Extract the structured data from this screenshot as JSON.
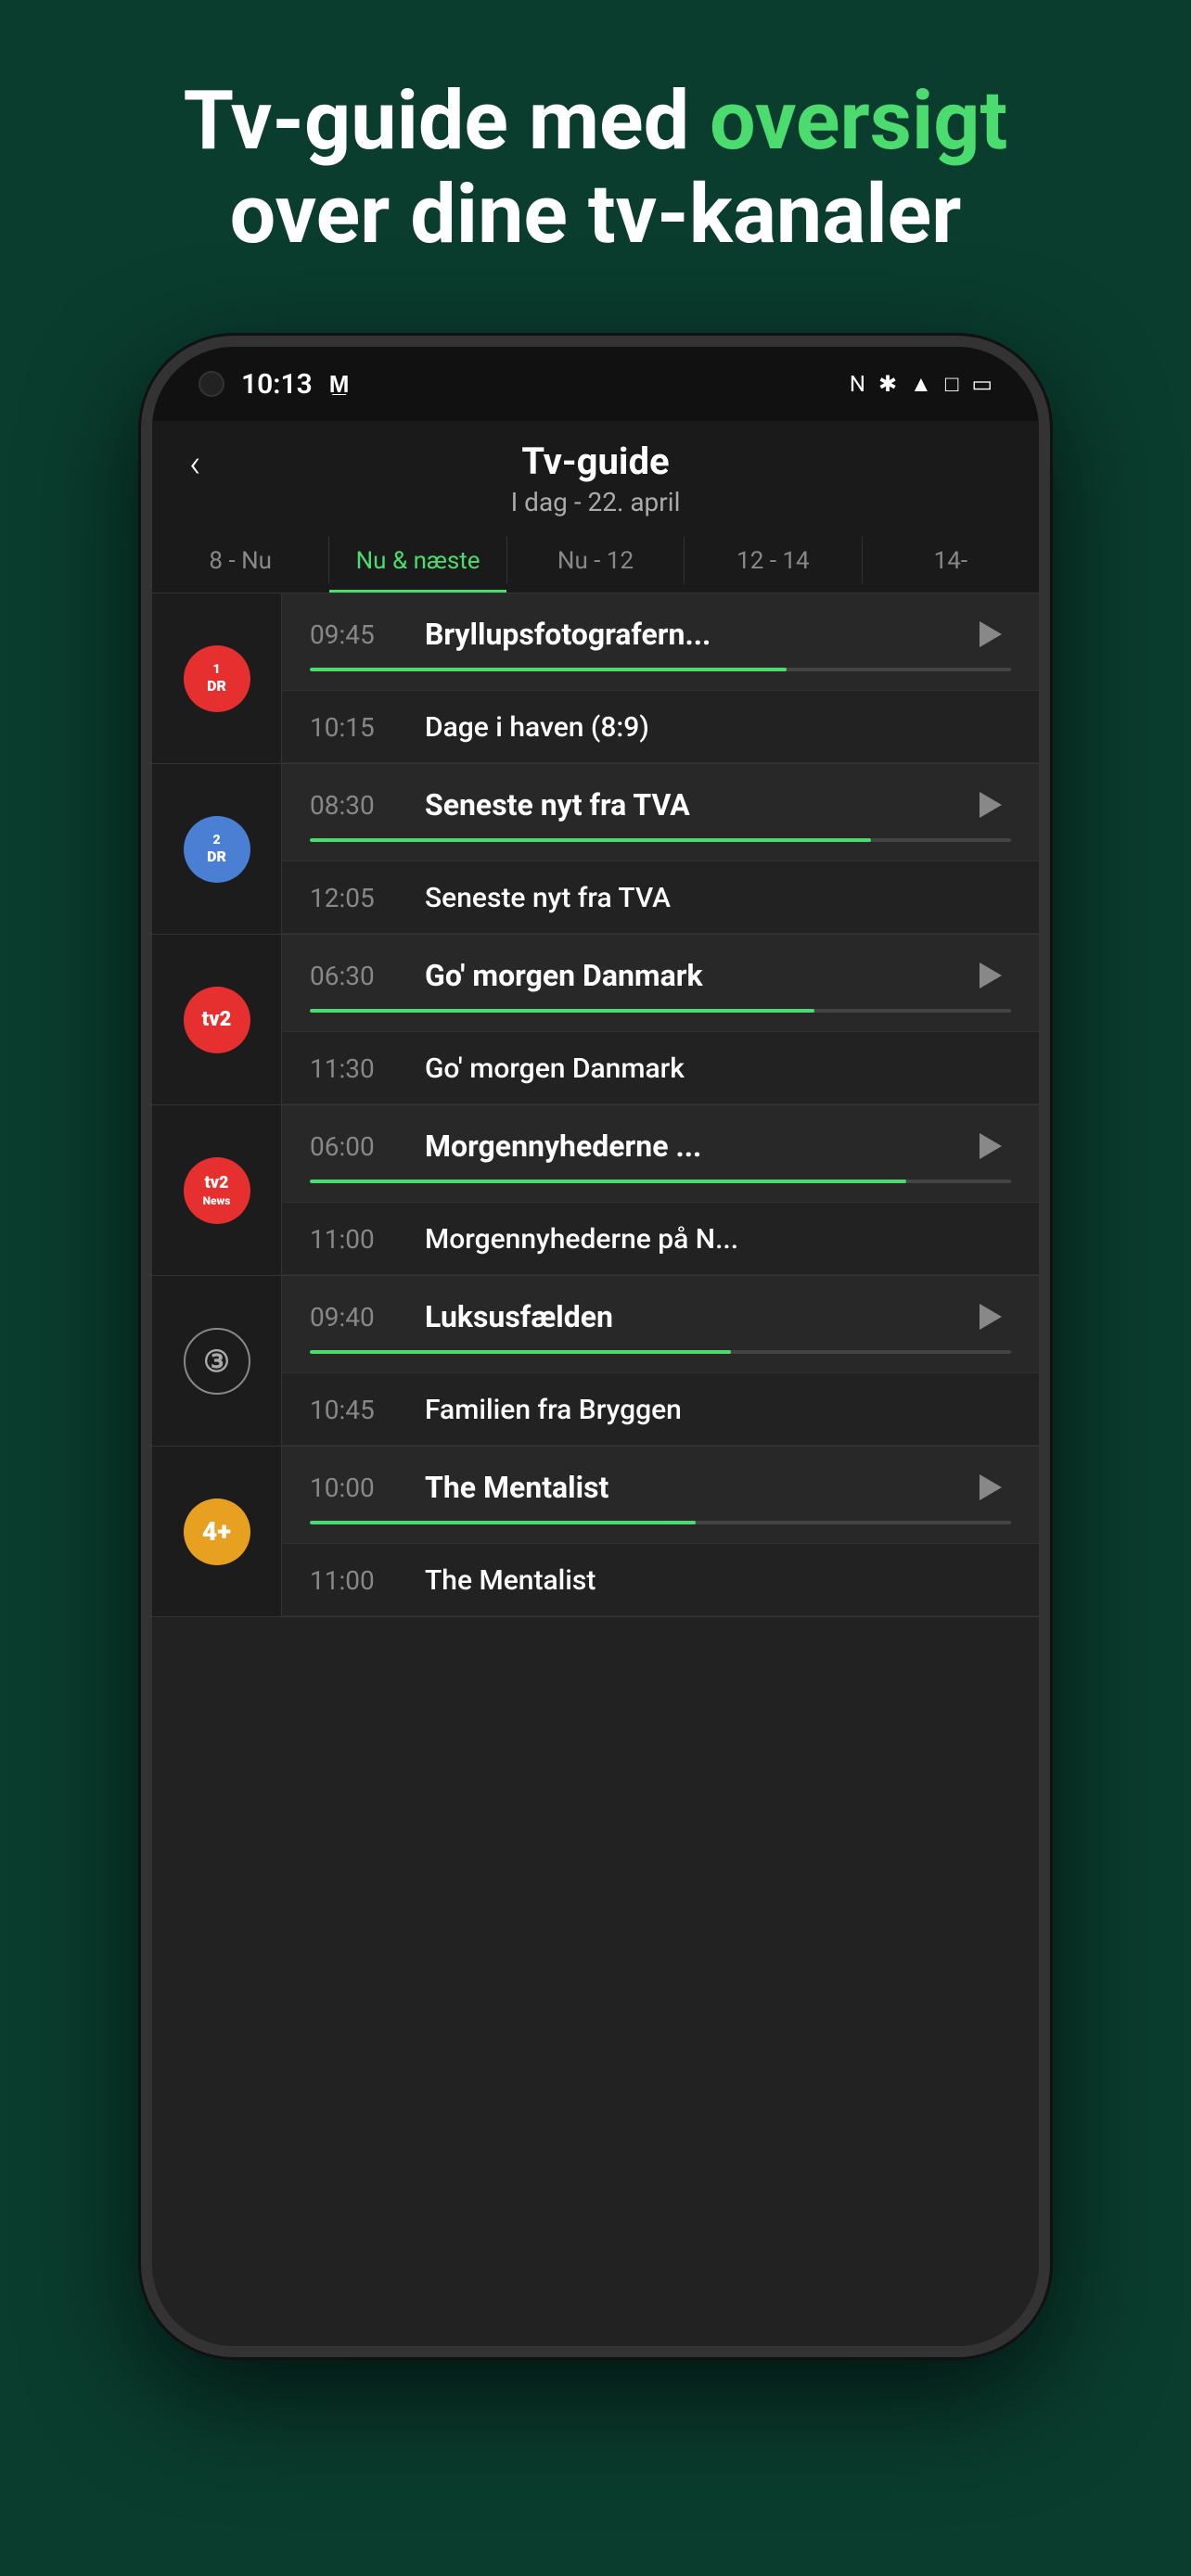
{
  "hero": {
    "line1": "Tv-guide med",
    "accent": "oversigt",
    "line2": "over dine tv-kanaler"
  },
  "status_bar": {
    "time": "10:13",
    "m_icon": "M"
  },
  "app_header": {
    "back_label": "‹",
    "title": "Tv-guide",
    "subtitle": "I dag - 22. april"
  },
  "tabs": [
    {
      "label": "8 - Nu",
      "active": false
    },
    {
      "label": "Nu & næste",
      "active": true
    },
    {
      "label": "Nu - 12",
      "active": false
    },
    {
      "label": "12 - 14",
      "active": false
    },
    {
      "label": "14-",
      "active": false
    }
  ],
  "channels": [
    {
      "id": "dr1",
      "logo_text": "1\nDR",
      "logo_class": "logo-dr1",
      "programs": [
        {
          "time": "09:45",
          "title": "Bryllupsfotografern...",
          "has_play": true,
          "progress": 68,
          "is_current": true
        },
        {
          "time": "10:15",
          "title": "Dage i haven (8:9)",
          "has_play": false,
          "is_current": false
        }
      ]
    },
    {
      "id": "dr2",
      "logo_text": "2\nDR",
      "logo_class": "logo-dr2",
      "programs": [
        {
          "time": "08:30",
          "title": "Seneste nyt fra TVA",
          "has_play": true,
          "progress": 80,
          "is_current": true
        },
        {
          "time": "12:05",
          "title": "Seneste nyt fra TVA",
          "has_play": false,
          "is_current": false
        }
      ]
    },
    {
      "id": "tv2",
      "logo_text": "tv2",
      "logo_class": "logo-tv2",
      "programs": [
        {
          "time": "06:30",
          "title": "Go' morgen Danmark",
          "has_play": true,
          "progress": 72,
          "is_current": true
        },
        {
          "time": "11:30",
          "title": "Go' morgen Danmark",
          "has_play": false,
          "is_current": false
        }
      ]
    },
    {
      "id": "tv2news",
      "logo_text": "tv2\nNews",
      "logo_class": "logo-tv2news",
      "programs": [
        {
          "time": "06:00",
          "title": "Morgennyhederne ...",
          "has_play": true,
          "progress": 85,
          "is_current": true
        },
        {
          "time": "11:00",
          "title": "Morgennyhederne på N...",
          "has_play": false,
          "is_current": false
        }
      ]
    },
    {
      "id": "ch3",
      "logo_text": "③",
      "logo_class": "logo-3",
      "programs": [
        {
          "time": "09:40",
          "title": "Luksusfælden",
          "has_play": true,
          "progress": 60,
          "is_current": true
        },
        {
          "time": "10:45",
          "title": "Familien fra Bryggen",
          "has_play": false,
          "is_current": false
        }
      ]
    },
    {
      "id": "ch4plus",
      "logo_text": "4+",
      "logo_class": "logo-4plus",
      "programs": [
        {
          "time": "10:00",
          "title": "The Mentalist",
          "has_play": true,
          "progress": 55,
          "is_current": true
        },
        {
          "time": "11:00",
          "title": "The Mentalist",
          "has_play": false,
          "is_current": false
        }
      ]
    }
  ]
}
